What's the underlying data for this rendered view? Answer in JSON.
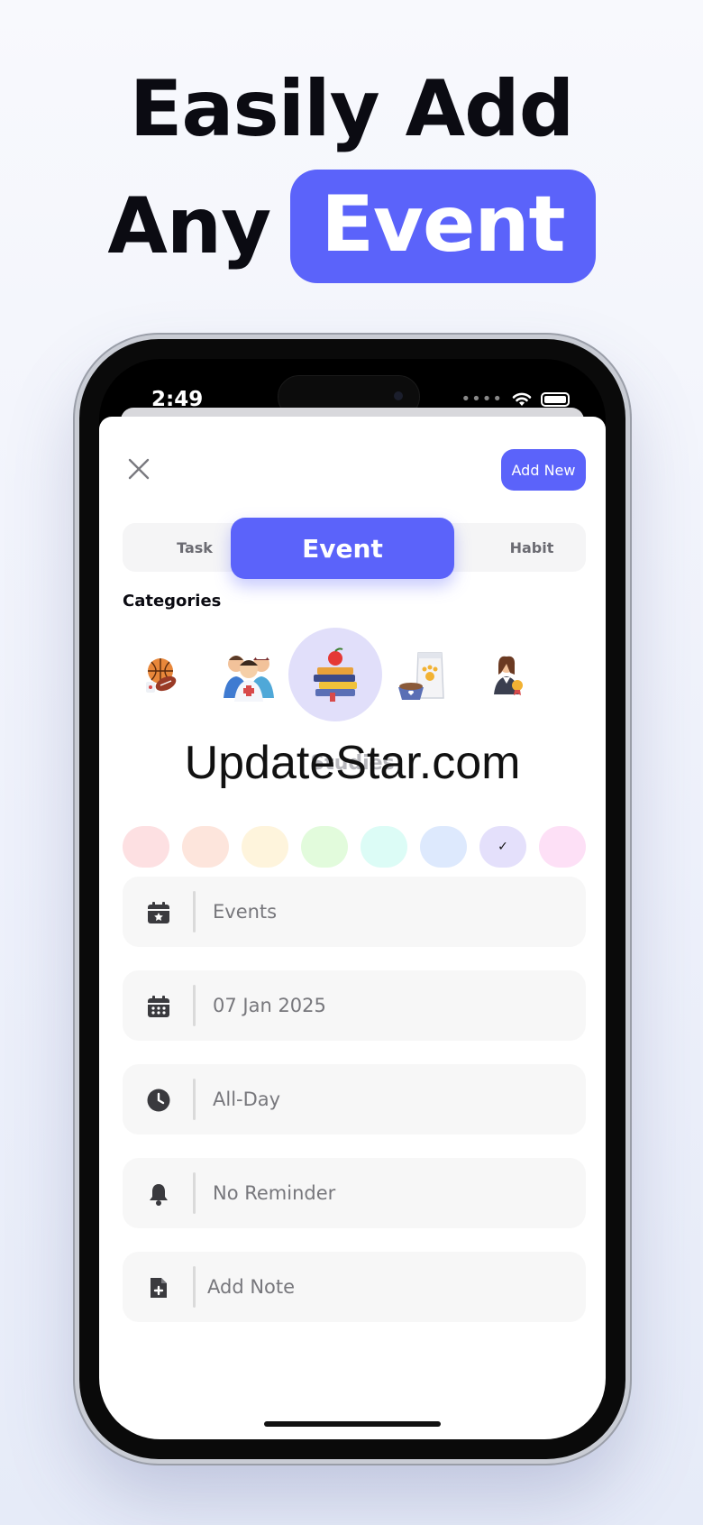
{
  "headline": {
    "line1": "Easily Add",
    "line2_prefix": "Any",
    "line2_highlight": "Event"
  },
  "accent_color": "#5b63fa",
  "status_bar": {
    "time": "2:49",
    "signal": "••••"
  },
  "sheet": {
    "add_button": "Add New",
    "tabs": {
      "task": "Task",
      "event": "Event",
      "habit": "Habit",
      "active": "Event"
    },
    "categories_title": "Categories",
    "categories": [
      {
        "icon": "sports-balls-icon"
      },
      {
        "icon": "medical-staff-icon"
      },
      {
        "icon": "studies-books-icon",
        "selected": true
      },
      {
        "icon": "pet-food-icon"
      },
      {
        "icon": "graduate-award-icon"
      }
    ],
    "selected_category_label": "Studies",
    "color_swatches": [
      {
        "color": "#fde0e2"
      },
      {
        "color": "#fde5dc"
      },
      {
        "color": "#fef4dc"
      },
      {
        "color": "#e2fbdc"
      },
      {
        "color": "#dcfcf6"
      },
      {
        "color": "#dde9fd"
      },
      {
        "color": "#e4e0fb",
        "selected": true,
        "check": "✓"
      },
      {
        "color": "#fde0f6"
      }
    ],
    "fields": {
      "title": "Events",
      "date": "07 Jan 2025",
      "time": "All-Day",
      "reminder": "No Reminder",
      "note": "Add Note"
    }
  },
  "watermark": "UpdateStar.com"
}
